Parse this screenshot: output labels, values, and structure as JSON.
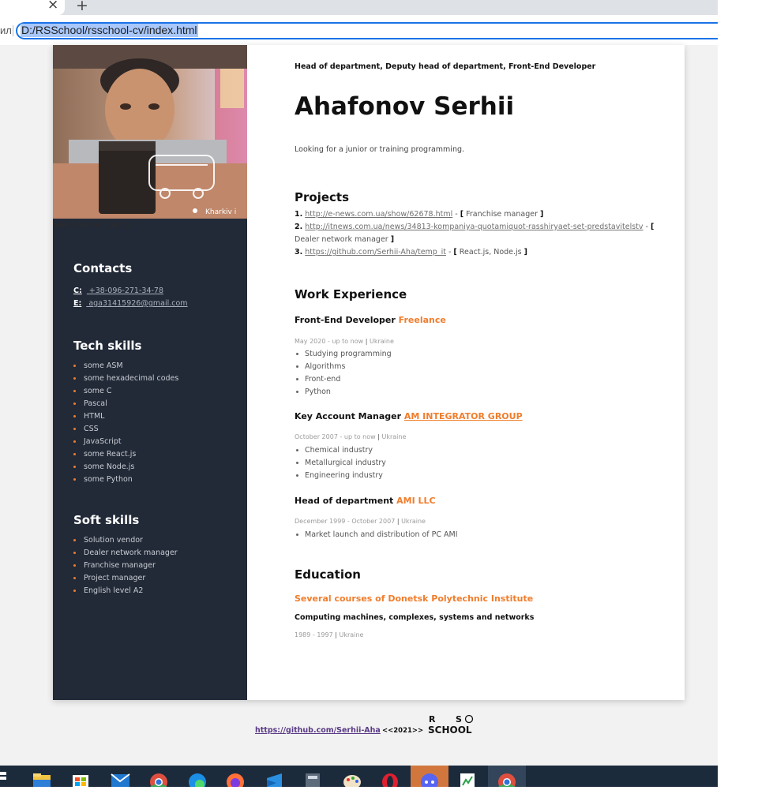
{
  "browser": {
    "tab_close": "×",
    "new_tab": "+",
    "address_prefix": "ил",
    "address": "D:/RSSchool/rsschool-cv/index.html"
  },
  "photo": {
    "alt_text": "Need another photo",
    "location_label": "Kharkiv i"
  },
  "sidebar": {
    "contacts_title": "Contacts",
    "contacts": [
      {
        "label": "C:",
        "value": " +38-096-271-34-78"
      },
      {
        "label": "E:",
        "value": " aga31415926@gmail.com"
      }
    ],
    "tech_title": "Tech skills",
    "tech_skills": [
      "some ASM",
      "some hexadecimal codes",
      "some C",
      "Pascal",
      "HTML",
      "CSS",
      "JavaScript",
      "some React.js",
      "some Node.js",
      "some Python"
    ],
    "soft_title": "Soft skills",
    "soft_skills": [
      "Solution vendor",
      "Dealer network manager",
      "Franchise manager",
      "Project manager",
      "English level A2"
    ]
  },
  "main": {
    "subtitle": "Head of department, Deputy head of department, Front-End Developer",
    "name": "Ahafonov Serhii",
    "objective": "Looking for a junior or training programming.",
    "projects_title": "Projects",
    "projects": [
      {
        "num": "1.",
        "url": "http://e-news.com.ua/show/62678.html",
        "role": "Franchise manager"
      },
      {
        "num": "2.",
        "url": "http://itnews.com.ua/news/34813-kompaniya-quotamiquot-rasshiryaet-set-predstavitelstv",
        "role": "Dealer network manager"
      },
      {
        "num": "3.",
        "url": "https://github.com/Serhii-Aha/temp_it",
        "role": "React.js, Node.js"
      }
    ],
    "work_title": "Work Experience",
    "jobs": [
      {
        "position": "Front-End Developer",
        "company": "Freelance",
        "period": "May 2020 - up to now",
        "place": "Ukraine",
        "items": [
          "Studying programming",
          "Algorithms",
          "Front-end",
          "Python"
        ]
      },
      {
        "position": "Key Account Manager",
        "company": "AM INTEGRATOR GROUP",
        "period": "October 2007 - up to now",
        "place": "Ukraine",
        "items": [
          "Chemical industry",
          "Metallurgical industry",
          "Engineering industry"
        ]
      },
      {
        "position": "Head of department",
        "company": "AMI LLC",
        "period": "December 1999 - October 2007",
        "place": "Ukraine",
        "items": [
          "Market launch and distribution of PC AMI"
        ]
      }
    ],
    "education_title": "Education",
    "education": {
      "institution": "Several courses of Donetsk Polytechnic Institute",
      "specialty": "Computing machines, complexes, systems and networks",
      "period": "1989 - 1997",
      "place": "Ukraine"
    }
  },
  "footer": {
    "github": "https://github.com/Serhii-Aha",
    "year": "<<2021>>",
    "logo_text": "RS SCHOOL"
  },
  "taskbar": {
    "apps": [
      "file-explorer-icon",
      "store-icon",
      "mail-icon",
      "chrome-icon",
      "edge-icon",
      "firefox-icon",
      "vscode-icon",
      "calculator-icon",
      "paint-icon",
      "opera-icon",
      "discord-icon",
      "notepad-icon",
      "chrome-icon"
    ]
  }
}
